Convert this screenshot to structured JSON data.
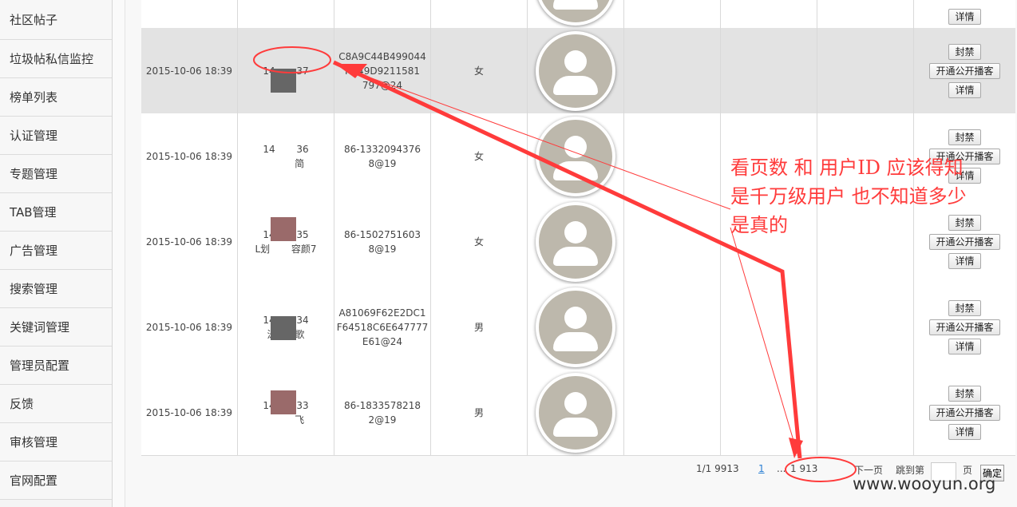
{
  "sidebar": {
    "items": [
      {
        "label": "社区帖子"
      },
      {
        "label": "垃圾帖私信监控"
      },
      {
        "label": "榜单列表"
      },
      {
        "label": "认证管理"
      },
      {
        "label": "专题管理"
      },
      {
        "label": "TAB管理"
      },
      {
        "label": "广告管理"
      },
      {
        "label": "搜索管理"
      },
      {
        "label": "关键词管理"
      },
      {
        "label": "管理员配置"
      },
      {
        "label": "反馈"
      },
      {
        "label": "审核管理"
      },
      {
        "label": "官网配置"
      }
    ]
  },
  "actions": {
    "ban": "封禁",
    "open_broadcast": "开通公开播客",
    "details": "详情"
  },
  "rows": [
    {
      "time": "2015-10-06 18:39",
      "user_id": "14       37",
      "user_id_2": "",
      "account": "C8A9C44B499044\n    FD49D9211581\n797@24",
      "gender": "女",
      "highlight": true
    },
    {
      "time": "2015-10-06 18:39",
      "user_id": "14       36",
      "user_id_2": "         简",
      "account": "86-1332094376\n8@19",
      "gender": "女",
      "highlight": false
    },
    {
      "time": "2015-10-06 18:39",
      "user_id": "14       35",
      "user_id_2": "L划       容颜7",
      "account": "86-1502751603\n8@19",
      "gender": "女",
      "highlight": false
    },
    {
      "time": "2015-10-06 18:39",
      "user_id": "14       34",
      "user_id_2": "泳      歌",
      "account": "A81069F62E2DC1\nF64518C6E647777\nE61@24",
      "gender": "男",
      "highlight": false
    },
    {
      "time": "2015-10-06 18:39",
      "user_id": "14       33",
      "user_id_2": "         飞",
      "account": "86-1833578218\n2@19",
      "gender": "男",
      "highlight": false
    }
  ],
  "pager": {
    "summary": "1/1     9913",
    "current": "1",
    "ellipsis": "...",
    "last": "1     913",
    "next": "下一页",
    "jump_label": "跳到第",
    "page_unit": "页",
    "confirm": "确定"
  },
  "annotation": {
    "line1": "看页数 和 用户ID 应该得知",
    "line2": "是千万级用户 也不知道多少",
    "line3": "是真的"
  },
  "watermark": "www.wooyun.org",
  "colors": {
    "annotation": "#ff3b3b",
    "highlight_row": "#e3e3e3",
    "pager_active": "#2a7fd4"
  }
}
